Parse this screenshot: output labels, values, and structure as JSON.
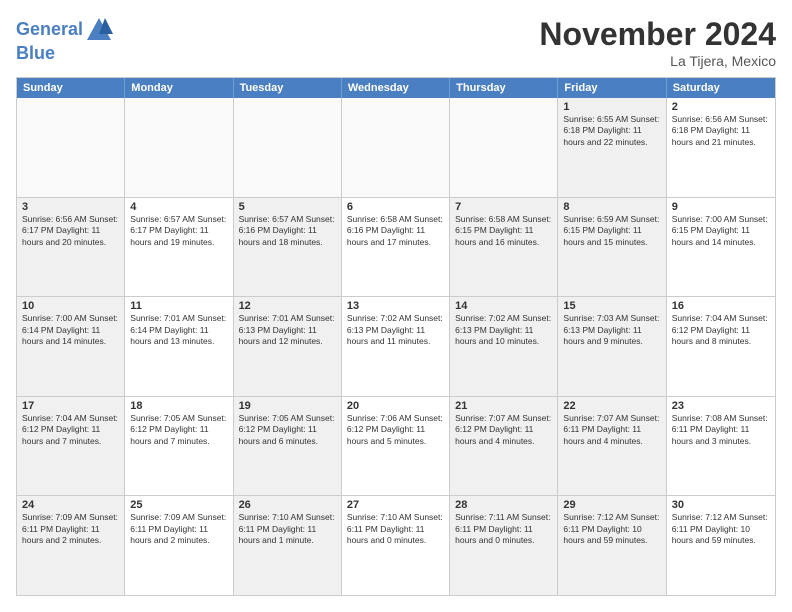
{
  "logo": {
    "line1": "General",
    "line2": "Blue"
  },
  "title": "November 2024",
  "location": "La Tijera, Mexico",
  "header_days": [
    "Sunday",
    "Monday",
    "Tuesday",
    "Wednesday",
    "Thursday",
    "Friday",
    "Saturday"
  ],
  "rows": [
    [
      {
        "day": "",
        "empty": true
      },
      {
        "day": "",
        "empty": true
      },
      {
        "day": "",
        "empty": true
      },
      {
        "day": "",
        "empty": true
      },
      {
        "day": "",
        "empty": true
      },
      {
        "day": "1",
        "shaded": true,
        "text": "Sunrise: 6:55 AM\nSunset: 6:18 PM\nDaylight: 11 hours\nand 22 minutes."
      },
      {
        "day": "2",
        "text": "Sunrise: 6:56 AM\nSunset: 6:18 PM\nDaylight: 11 hours\nand 21 minutes."
      }
    ],
    [
      {
        "day": "3",
        "shaded": true,
        "text": "Sunrise: 6:56 AM\nSunset: 6:17 PM\nDaylight: 11 hours\nand 20 minutes."
      },
      {
        "day": "4",
        "text": "Sunrise: 6:57 AM\nSunset: 6:17 PM\nDaylight: 11 hours\nand 19 minutes."
      },
      {
        "day": "5",
        "shaded": true,
        "text": "Sunrise: 6:57 AM\nSunset: 6:16 PM\nDaylight: 11 hours\nand 18 minutes."
      },
      {
        "day": "6",
        "text": "Sunrise: 6:58 AM\nSunset: 6:16 PM\nDaylight: 11 hours\nand 17 minutes."
      },
      {
        "day": "7",
        "shaded": true,
        "text": "Sunrise: 6:58 AM\nSunset: 6:15 PM\nDaylight: 11 hours\nand 16 minutes."
      },
      {
        "day": "8",
        "shaded": true,
        "text": "Sunrise: 6:59 AM\nSunset: 6:15 PM\nDaylight: 11 hours\nand 15 minutes."
      },
      {
        "day": "9",
        "text": "Sunrise: 7:00 AM\nSunset: 6:15 PM\nDaylight: 11 hours\nand 14 minutes."
      }
    ],
    [
      {
        "day": "10",
        "shaded": true,
        "text": "Sunrise: 7:00 AM\nSunset: 6:14 PM\nDaylight: 11 hours\nand 14 minutes."
      },
      {
        "day": "11",
        "text": "Sunrise: 7:01 AM\nSunset: 6:14 PM\nDaylight: 11 hours\nand 13 minutes."
      },
      {
        "day": "12",
        "shaded": true,
        "text": "Sunrise: 7:01 AM\nSunset: 6:13 PM\nDaylight: 11 hours\nand 12 minutes."
      },
      {
        "day": "13",
        "text": "Sunrise: 7:02 AM\nSunset: 6:13 PM\nDaylight: 11 hours\nand 11 minutes."
      },
      {
        "day": "14",
        "shaded": true,
        "text": "Sunrise: 7:02 AM\nSunset: 6:13 PM\nDaylight: 11 hours\nand 10 minutes."
      },
      {
        "day": "15",
        "shaded": true,
        "text": "Sunrise: 7:03 AM\nSunset: 6:13 PM\nDaylight: 11 hours\nand 9 minutes."
      },
      {
        "day": "16",
        "text": "Sunrise: 7:04 AM\nSunset: 6:12 PM\nDaylight: 11 hours\nand 8 minutes."
      }
    ],
    [
      {
        "day": "17",
        "shaded": true,
        "text": "Sunrise: 7:04 AM\nSunset: 6:12 PM\nDaylight: 11 hours\nand 7 minutes."
      },
      {
        "day": "18",
        "text": "Sunrise: 7:05 AM\nSunset: 6:12 PM\nDaylight: 11 hours\nand 7 minutes."
      },
      {
        "day": "19",
        "shaded": true,
        "text": "Sunrise: 7:05 AM\nSunset: 6:12 PM\nDaylight: 11 hours\nand 6 minutes."
      },
      {
        "day": "20",
        "text": "Sunrise: 7:06 AM\nSunset: 6:12 PM\nDaylight: 11 hours\nand 5 minutes."
      },
      {
        "day": "21",
        "shaded": true,
        "text": "Sunrise: 7:07 AM\nSunset: 6:12 PM\nDaylight: 11 hours\nand 4 minutes."
      },
      {
        "day": "22",
        "shaded": true,
        "text": "Sunrise: 7:07 AM\nSunset: 6:11 PM\nDaylight: 11 hours\nand 4 minutes."
      },
      {
        "day": "23",
        "text": "Sunrise: 7:08 AM\nSunset: 6:11 PM\nDaylight: 11 hours\nand 3 minutes."
      }
    ],
    [
      {
        "day": "24",
        "shaded": true,
        "text": "Sunrise: 7:09 AM\nSunset: 6:11 PM\nDaylight: 11 hours\nand 2 minutes."
      },
      {
        "day": "25",
        "text": "Sunrise: 7:09 AM\nSunset: 6:11 PM\nDaylight: 11 hours\nand 2 minutes."
      },
      {
        "day": "26",
        "shaded": true,
        "text": "Sunrise: 7:10 AM\nSunset: 6:11 PM\nDaylight: 11 hours\nand 1 minute."
      },
      {
        "day": "27",
        "text": "Sunrise: 7:10 AM\nSunset: 6:11 PM\nDaylight: 11 hours\nand 0 minutes."
      },
      {
        "day": "28",
        "shaded": true,
        "text": "Sunrise: 7:11 AM\nSunset: 6:11 PM\nDaylight: 11 hours\nand 0 minutes."
      },
      {
        "day": "29",
        "shaded": true,
        "text": "Sunrise: 7:12 AM\nSunset: 6:11 PM\nDaylight: 10 hours\nand 59 minutes."
      },
      {
        "day": "30",
        "text": "Sunrise: 7:12 AM\nSunset: 6:11 PM\nDaylight: 10 hours\nand 59 minutes."
      }
    ]
  ]
}
